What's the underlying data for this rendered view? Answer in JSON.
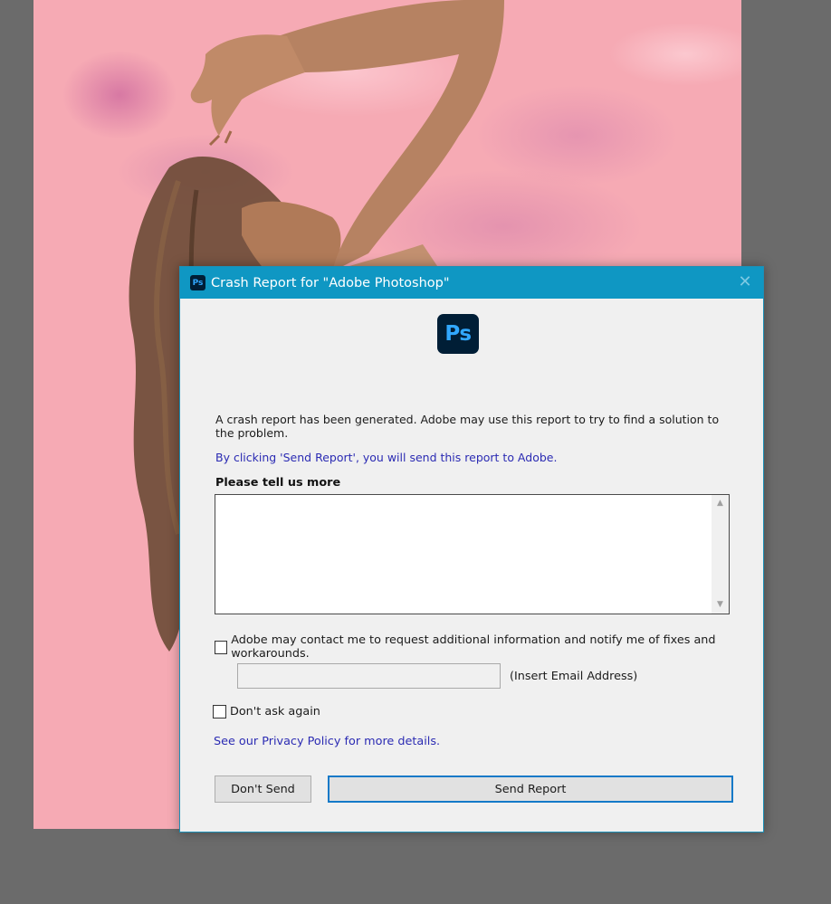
{
  "dialog": {
    "title": "Crash Report for \"Adobe Photoshop\"",
    "title_icon_text": "Ps",
    "logo_text": "Ps",
    "message": "A crash report has been generated. Adobe may use this report to try to find a solution to the problem.",
    "send_info": "By clicking 'Send Report', you will send this report to Adobe.",
    "feedback_label": "Please tell us more",
    "feedback_value": "",
    "contact_checkbox": {
      "label": "Adobe may contact me to request additional information and notify me of fixes and workarounds.",
      "checked": false
    },
    "email_input": {
      "value": ""
    },
    "email_hint": "(Insert Email Address)",
    "dont_ask_checkbox": {
      "label": "Don't ask again",
      "checked": false
    },
    "privacy_link": "See our Privacy Policy for more details.",
    "buttons": {
      "dont_send": "Don't Send",
      "send_report": "Send Report"
    }
  },
  "icons": {
    "close": "close-icon",
    "scroll_up": "chevron-up-icon",
    "scroll_down": "chevron-down-icon"
  },
  "colors": {
    "titlebar": "#0f97c3",
    "link": "#2b2bb3",
    "ps_logo_bg": "#001e36",
    "ps_logo_fg": "#31a8ff",
    "canvas_bg": "#f6aab4",
    "workspace_bg": "#6b6b6b"
  }
}
